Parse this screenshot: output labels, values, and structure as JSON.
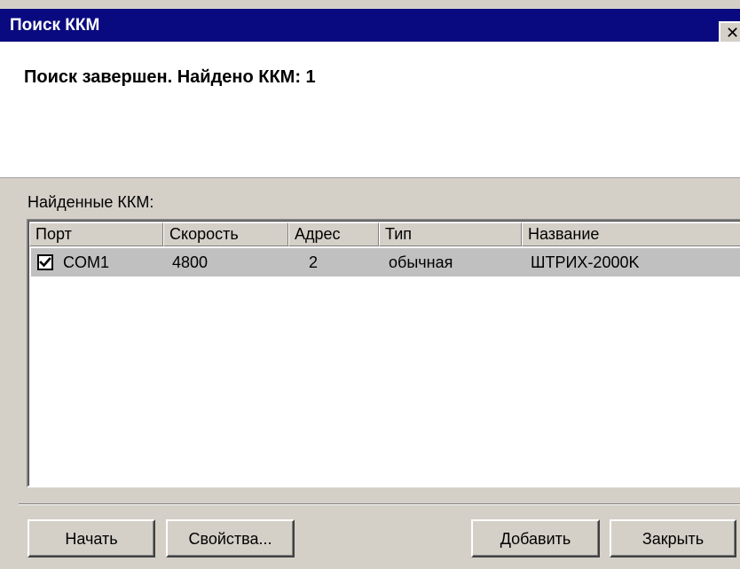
{
  "window": {
    "title": "Поиск ККМ",
    "close_glyph": "✕",
    "title_bar_color": "#0a0a80"
  },
  "status_text": "Поиск завершен. Найдено ККМ: 1",
  "found_label": "Найденные ККМ:",
  "table": {
    "columns": [
      "Порт",
      "Скорость",
      "Адрес",
      "Тип",
      "Название"
    ],
    "rows": [
      {
        "checked": true,
        "port": "COM1",
        "speed": "4800",
        "address": "2",
        "type": "обычная",
        "name": "ШТРИХ-2000K"
      }
    ]
  },
  "buttons": {
    "start": "Начать",
    "properties": "Свойства...",
    "add": "Добавить",
    "close": "Закрыть"
  }
}
